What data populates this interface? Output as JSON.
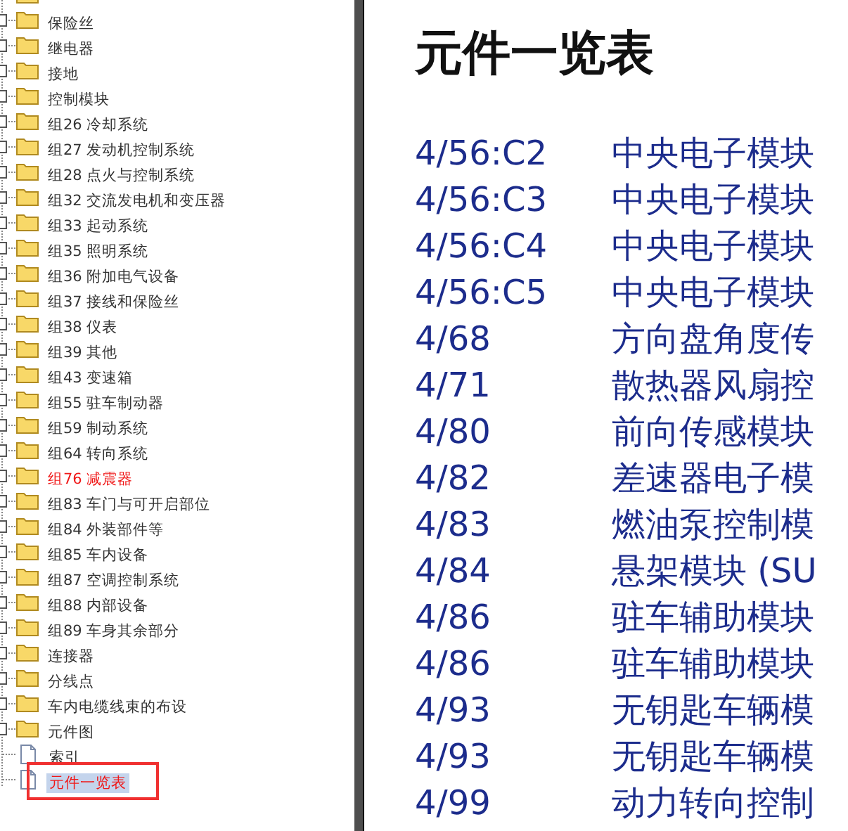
{
  "tree": [
    {
      "label": "保险丝",
      "kind": "folder",
      "highlighted": false,
      "selected": false
    },
    {
      "label": "继电器",
      "kind": "folder",
      "highlighted": false,
      "selected": false
    },
    {
      "label": "接地",
      "kind": "folder",
      "highlighted": false,
      "selected": false
    },
    {
      "label": "控制模块",
      "kind": "folder",
      "highlighted": false,
      "selected": false
    },
    {
      "label": "组26 冷却系统",
      "kind": "folder",
      "highlighted": false,
      "selected": false
    },
    {
      "label": "组27 发动机控制系统",
      "kind": "folder",
      "highlighted": false,
      "selected": false
    },
    {
      "label": "组28 点火与控制系统",
      "kind": "folder",
      "highlighted": false,
      "selected": false
    },
    {
      "label": "组32 交流发电机和变压器",
      "kind": "folder",
      "highlighted": false,
      "selected": false
    },
    {
      "label": "组33 起动系统",
      "kind": "folder",
      "highlighted": false,
      "selected": false
    },
    {
      "label": "组35 照明系统",
      "kind": "folder",
      "highlighted": false,
      "selected": false
    },
    {
      "label": "组36 附加电气设备",
      "kind": "folder",
      "highlighted": false,
      "selected": false
    },
    {
      "label": "组37 接线和保险丝",
      "kind": "folder",
      "highlighted": false,
      "selected": false
    },
    {
      "label": "组38 仪表",
      "kind": "folder",
      "highlighted": false,
      "selected": false
    },
    {
      "label": "组39 其他",
      "kind": "folder",
      "highlighted": false,
      "selected": false
    },
    {
      "label": "组43 变速箱",
      "kind": "folder",
      "highlighted": false,
      "selected": false
    },
    {
      "label": "组55 驻车制动器",
      "kind": "folder",
      "highlighted": false,
      "selected": false
    },
    {
      "label": "组59 制动系统",
      "kind": "folder",
      "highlighted": false,
      "selected": false
    },
    {
      "label": "组64 转向系统",
      "kind": "folder",
      "highlighted": false,
      "selected": false
    },
    {
      "label": "组76 减震器",
      "kind": "folder",
      "highlighted": true,
      "selected": false
    },
    {
      "label": "组83 车门与可开启部位",
      "kind": "folder",
      "highlighted": false,
      "selected": false
    },
    {
      "label": "组84 外装部件等",
      "kind": "folder",
      "highlighted": false,
      "selected": false
    },
    {
      "label": "组85 车内设备",
      "kind": "folder",
      "highlighted": false,
      "selected": false
    },
    {
      "label": "组87 空调控制系统",
      "kind": "folder",
      "highlighted": false,
      "selected": false
    },
    {
      "label": "组88 内部设备",
      "kind": "folder",
      "highlighted": false,
      "selected": false
    },
    {
      "label": "组89 车身其余部分",
      "kind": "folder",
      "highlighted": false,
      "selected": false
    },
    {
      "label": "连接器",
      "kind": "folder",
      "highlighted": false,
      "selected": false
    },
    {
      "label": "分线点",
      "kind": "folder",
      "highlighted": false,
      "selected": false
    },
    {
      "label": "车内电缆线束的布设",
      "kind": "folder",
      "highlighted": false,
      "selected": false
    },
    {
      "label": "元件图",
      "kind": "folder",
      "highlighted": false,
      "selected": false
    },
    {
      "label": "索引",
      "kind": "document",
      "highlighted": false,
      "selected": false
    },
    {
      "label": "元件一览表",
      "kind": "document",
      "highlighted": true,
      "selected": true
    }
  ],
  "document": {
    "title": "元件一览表",
    "rows": [
      {
        "code": "4/56:C2",
        "name": "中央电子模块"
      },
      {
        "code": "4/56:C3",
        "name": "中央电子模块"
      },
      {
        "code": "4/56:C4",
        "name": "中央电子模块"
      },
      {
        "code": "4/56:C5",
        "name": "中央电子模块"
      },
      {
        "code": "4/68",
        "name": "方向盘角度传"
      },
      {
        "code": "4/71",
        "name": "散热器风扇控"
      },
      {
        "code": "4/80",
        "name": "前向传感模块"
      },
      {
        "code": "4/82",
        "name": "差速器电子模"
      },
      {
        "code": "4/83",
        "name": "燃油泵控制模"
      },
      {
        "code": "4/84",
        "name": "悬架模块 (SU"
      },
      {
        "code": "4/86",
        "name": "驻车辅助模块"
      },
      {
        "code": "4/86",
        "name": "驻车辅助模块"
      },
      {
        "code": "4/93",
        "name": "无钥匙车辆模"
      },
      {
        "code": "4/93",
        "name": "无钥匙车辆模"
      },
      {
        "code": "4/99",
        "name": "动力转向控制"
      }
    ]
  }
}
